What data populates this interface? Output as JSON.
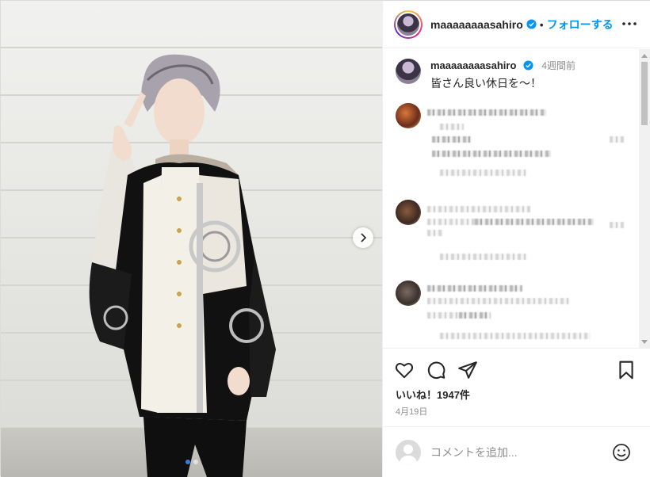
{
  "post": {
    "username": "maaaaaaaasahiro",
    "separator": "•",
    "follow_label": "フォローする",
    "more_icon": "more-horizontal-icon"
  },
  "caption": {
    "username": "maaaaaaaasahiro",
    "time": "4週間前",
    "text": "皆さん良い休日を〜！"
  },
  "photo": {
    "slide_count": 2,
    "active_slide": 1,
    "next_icon": "chevron-right-icon"
  },
  "actions": {
    "like_icon": "heart-icon",
    "comment_icon": "comment-icon",
    "share_icon": "paper-plane-icon",
    "save_icon": "bookmark-icon"
  },
  "likes_text": "いいね！1947件",
  "date_text": "4月19日",
  "comment_input": {
    "placeholder": "コメントを追加...",
    "emoji_icon": "smile-icon"
  },
  "colors": {
    "accent": "#0095f6",
    "text": "#262626",
    "muted": "#8e8e8e"
  }
}
